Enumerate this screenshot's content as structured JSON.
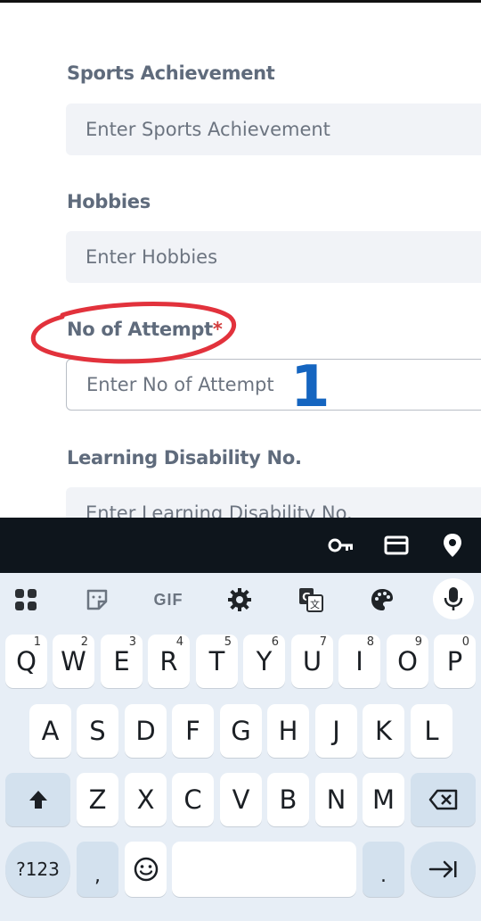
{
  "form": {
    "sports": {
      "label": "Sports Achievement",
      "placeholder": "Enter Sports Achievement"
    },
    "hobbies": {
      "label": "Hobbies",
      "placeholder": "Enter Hobbies"
    },
    "attempt": {
      "label": "No of Attempt",
      "required": "*",
      "placeholder": "Enter No of Attempt"
    },
    "disability": {
      "label": "Learning Disability No.",
      "placeholder": "Enter Learning Disability No."
    }
  },
  "annotation": {
    "number": "1",
    "ellipse_color": "#e2323c",
    "number_color": "#1565c0"
  },
  "autofill_bar": {
    "icons": [
      "key-icon",
      "card-icon",
      "location-pin-icon"
    ]
  },
  "toolbar": {
    "icons": [
      "apps-grid-icon",
      "sticker-icon",
      "gif-icon",
      "settings-gear-icon",
      "translate-icon",
      "palette-icon",
      "microphone-icon"
    ],
    "gif_label": "GIF"
  },
  "keys": {
    "row1": [
      {
        "k": "Q",
        "n": "1"
      },
      {
        "k": "W",
        "n": "2"
      },
      {
        "k": "E",
        "n": "3"
      },
      {
        "k": "R",
        "n": "4"
      },
      {
        "k": "T",
        "n": "5"
      },
      {
        "k": "Y",
        "n": "6"
      },
      {
        "k": "U",
        "n": "7"
      },
      {
        "k": "I",
        "n": "8"
      },
      {
        "k": "O",
        "n": "9"
      },
      {
        "k": "P",
        "n": "0"
      }
    ],
    "row2": [
      "A",
      "S",
      "D",
      "F",
      "G",
      "H",
      "J",
      "K",
      "L"
    ],
    "row3": [
      "Z",
      "X",
      "C",
      "V",
      "B",
      "N",
      "M"
    ],
    "symbols": "?123",
    "comma": ",",
    "period": "."
  },
  "colors": {
    "label": "#5f6b7c",
    "field_bg": "#f1f3f7",
    "keyboard_bg": "#e7eef6",
    "required": "#d23b3b"
  }
}
